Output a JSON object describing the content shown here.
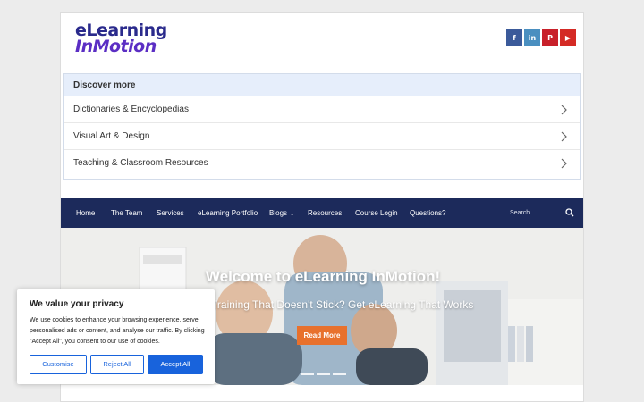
{
  "logo": {
    "line1": "eLearning",
    "line2": "InMotion"
  },
  "social": [
    {
      "icon": "facebook-icon",
      "glyph": "f",
      "color": "#3b5a9a"
    },
    {
      "icon": "linkedin-icon",
      "glyph": "in",
      "color": "#4a8fc0"
    },
    {
      "icon": "pinterest-icon",
      "glyph": "P",
      "color": "#c8202a"
    },
    {
      "icon": "youtube-icon",
      "glyph": "▶",
      "color": "#d42a25"
    }
  ],
  "discover": {
    "heading": "Discover more",
    "items": [
      {
        "label": "Dictionaries & Encyclopedias"
      },
      {
        "label": "Visual Art & Design"
      },
      {
        "label": "Teaching & Classroom Resources"
      }
    ]
  },
  "nav": {
    "items": [
      {
        "label": "Home"
      },
      {
        "label": "The Team"
      },
      {
        "label": "Services"
      },
      {
        "label": "eLearning Portfolio"
      },
      {
        "label": "Blogs ⌄"
      },
      {
        "label": "Resources"
      },
      {
        "label": "Course Login"
      },
      {
        "label": "Questions?"
      }
    ],
    "search_placeholder": "Search"
  },
  "hero": {
    "title": "Welcome to eLearning InMotion!",
    "subtitle": "Tired of Training That Doesn't Stick? Get eLearning That Works",
    "button": "Read More"
  },
  "cookie": {
    "title": "We value your privacy",
    "body": "We use cookies to enhance your browsing experience, serve personalised ads or content, and analyse our traffic. By clicking \"Accept All\", you consent to our use of cookies.",
    "customise": "Customise",
    "reject": "Reject All",
    "accept": "Accept All"
  },
  "colors": {
    "nav_bg": "#1c2a5b",
    "accent_orange": "#e8712d",
    "cookie_blue": "#1863dc",
    "discover_head_bg": "#e6eefb"
  }
}
